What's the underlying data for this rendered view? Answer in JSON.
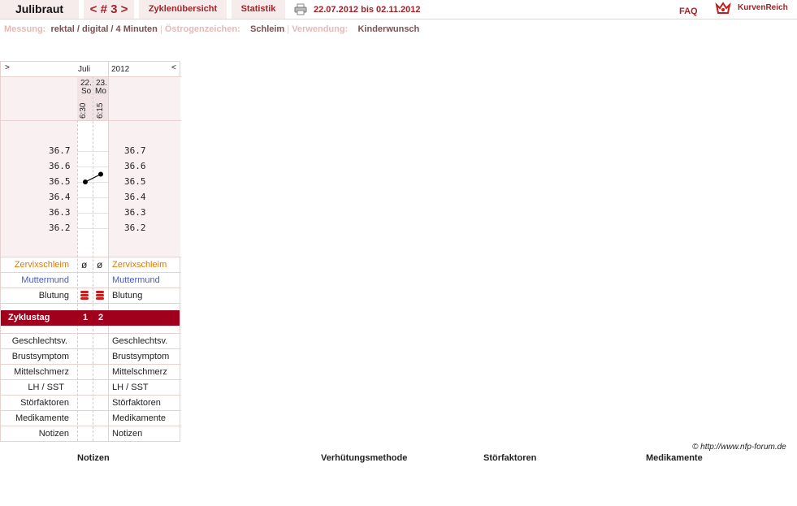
{
  "header": {
    "user": "Julibraut",
    "cycle_nav": "< # 3 >",
    "tab_overview": "Zyklenübersicht",
    "tab_stats": "Statistik",
    "date_range": "22.07.2012 bis 02.11.2012",
    "faq": "FAQ",
    "brand": "KurvenReich"
  },
  "settings": {
    "measure_label": "Messung:",
    "measure_value": "rektal / digital / 4 Minuten",
    "estrogen_label": "Östrogenzeichen:",
    "estrogen_value": "Schleim",
    "use_label": "Verwendung:",
    "use_value": "Kinderwunsch"
  },
  "chart": {
    "nav_left": ">",
    "nav_right": "<",
    "month": "Juli",
    "year": "2012",
    "days": [
      {
        "date": "22.",
        "weekday": "So",
        "time": "6:30",
        "temp": 36.5,
        "cervix": "ø",
        "cycle_day": "1"
      },
      {
        "date": "23.",
        "weekday": "Mo",
        "time": "6:15",
        "temp": 36.55,
        "cervix": "ø",
        "cycle_day": "2"
      }
    ],
    "temp_ticks": [
      "36.7",
      "36.6",
      "36.5",
      "36.4",
      "36.3",
      "36.2"
    ],
    "rows": {
      "cervix_mucus": "Zervixschleim",
      "cervix": "Muttermund",
      "bleeding": "Blutung",
      "cycle_day": "Zyklustag",
      "intercourse": "Geschlechtsv.",
      "breast": "Brustsymptom",
      "midpain": "Mittelschmerz",
      "lh": "LH / SST",
      "disturb": "Störfaktoren",
      "meds": "Medikamente",
      "notes": "Notizen"
    },
    "colors": {
      "mucus": "#e07b00",
      "cervix": "#4a5bbf",
      "accent": "#a0001c"
    }
  },
  "footer": {
    "copyright": "© http://www.nfp-forum.de",
    "col_notes": "Notizen",
    "col_contraception": "Verhütungsmethode",
    "col_disturb": "Störfaktoren",
    "col_meds": "Medikamente"
  }
}
